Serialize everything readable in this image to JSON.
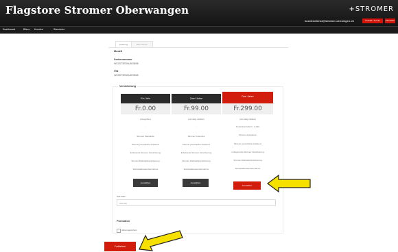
{
  "header": {
    "title": "Flagstore Stromer Oberwangen",
    "logo": "+STROMER",
    "email": "kundendienst@stromer-oensingen.ch",
    "buttons": [
      "Kontakt / Termin",
      "Abmelden"
    ]
  },
  "nav": [
    "Dashboard",
    "Bikes",
    "Kunden",
    "Standorte"
  ],
  "tabs": [
    "Lieferung",
    "Bike Pakete"
  ],
  "fields": [
    {
      "label": "Modell",
      "value": ""
    },
    {
      "label": "Seriennummer",
      "value": "WS3ST3R3NU5E0808"
    },
    {
      "label": "VIN",
      "value": "WS3ST3R3NU5E0808"
    }
  ],
  "section_label": "Versicherung",
  "plans": [
    {
      "header": "Ein Jahr",
      "price": "Fr.0.00",
      "note": "(inbegriffen)",
      "features": [
        "-",
        "Stromer Standarde",
        "Stromer persönliche Assistenz",
        "Erhebende Stromer Versicherung",
        "Stromer Diebstahlversicherung",
        "Werkstattkostenübernahme"
      ],
      "button": "Auswählen"
    },
    {
      "header": "Zwei Jahre",
      "price": "Fr.99.00",
      "note": "(einmalig zahlbar)",
      "features": [
        "-",
        "Stromer Kostenlos",
        "Stromer persönliche Assistenz",
        "Erhebende Stromer Versicherung",
        "Stromer Diebstahlversicherung",
        "Werkstattkostenübernahme"
      ],
      "button": "Auswählen"
    },
    {
      "header": "Drei Jahre",
      "price": "Fr.299.00",
      "note": "(einmalig zahlbar)",
      "features": [
        "Kostenkontrolle Fr. 1 Jahr",
        "Stromer Assistance",
        "Stromer persönliche Assistenz",
        "Unbegrenzte Stromer Versicherung",
        "Stromer Diebstahlversicherung",
        "Werkstattkostenübernahme"
      ],
      "button": "Auswählen"
    }
  ],
  "custom_field": {
    "label": "Sub-Titel *",
    "value": "Sub-titel"
  },
  "promotion": {
    "label": "Promotion",
    "checkbox_label": "Aktionsgutschein"
  },
  "continue_label": "Fortfahren",
  "colors": {
    "accent": "#d21c0c",
    "arrow": "#f6e000"
  }
}
